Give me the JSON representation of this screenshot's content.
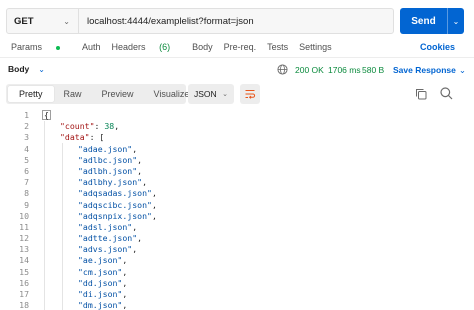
{
  "request": {
    "method": "GET",
    "url": "localhost:4444/examplelist?format=json",
    "send_label": "Send"
  },
  "request_tabs": [
    {
      "label": "Params",
      "has_dot": true
    },
    {
      "label": "Auth"
    },
    {
      "label": "Headers",
      "count": "(6)"
    },
    {
      "label": "Body"
    },
    {
      "label": "Pre-req."
    },
    {
      "label": "Tests"
    },
    {
      "label": "Settings"
    }
  ],
  "cookies_label": "Cookies",
  "response": {
    "body_label": "Body",
    "status": "200 OK",
    "time": "1706 ms",
    "size": "580 B",
    "save_label": "Save Response"
  },
  "format_tabs": [
    "Pretty",
    "Raw",
    "Preview",
    "Visualize"
  ],
  "active_format": "Pretty",
  "language": "JSON",
  "code_lines": [
    {
      "n": "1",
      "parts": [
        [
          "brace",
          "{"
        ]
      ]
    },
    {
      "n": "2",
      "parts": [
        [
          "key",
          "\"count\""
        ],
        [
          "pun",
          ": "
        ],
        [
          "num",
          "38"
        ],
        [
          "pun",
          ","
        ]
      ]
    },
    {
      "n": "3",
      "parts": [
        [
          "key",
          "\"data\""
        ],
        [
          "pun",
          ": ["
        ]
      ]
    },
    {
      "n": "4",
      "parts": [
        [
          "str",
          "\"adae.json\""
        ],
        [
          "pun",
          ","
        ]
      ]
    },
    {
      "n": "5",
      "parts": [
        [
          "str",
          "\"adlbc.json\""
        ],
        [
          "pun",
          ","
        ]
      ]
    },
    {
      "n": "6",
      "parts": [
        [
          "str",
          "\"adlbh.json\""
        ],
        [
          "pun",
          ","
        ]
      ]
    },
    {
      "n": "7",
      "parts": [
        [
          "str",
          "\"adlbhy.json\""
        ],
        [
          "pun",
          ","
        ]
      ]
    },
    {
      "n": "8",
      "parts": [
        [
          "str",
          "\"adqsadas.json\""
        ],
        [
          "pun",
          ","
        ]
      ]
    },
    {
      "n": "9",
      "parts": [
        [
          "str",
          "\"adqscibc.json\""
        ],
        [
          "pun",
          ","
        ]
      ]
    },
    {
      "n": "10",
      "parts": [
        [
          "str",
          "\"adqsnpix.json\""
        ],
        [
          "pun",
          ","
        ]
      ]
    },
    {
      "n": "11",
      "parts": [
        [
          "str",
          "\"adsl.json\""
        ],
        [
          "pun",
          ","
        ]
      ]
    },
    {
      "n": "12",
      "parts": [
        [
          "str",
          "\"adtte.json\""
        ],
        [
          "pun",
          ","
        ]
      ]
    },
    {
      "n": "13",
      "parts": [
        [
          "str",
          "\"advs.json\""
        ],
        [
          "pun",
          ","
        ]
      ]
    },
    {
      "n": "14",
      "parts": [
        [
          "str",
          "\"ae.json\""
        ],
        [
          "pun",
          ","
        ]
      ]
    },
    {
      "n": "15",
      "parts": [
        [
          "str",
          "\"cm.json\""
        ],
        [
          "pun",
          ","
        ]
      ]
    },
    {
      "n": "16",
      "parts": [
        [
          "str",
          "\"dd.json\""
        ],
        [
          "pun",
          ","
        ]
      ]
    },
    {
      "n": "17",
      "parts": [
        [
          "str",
          "\"di.json\""
        ],
        [
          "pun",
          ","
        ]
      ]
    },
    {
      "n": "18",
      "parts": [
        [
          "str",
          "\"dm.json\""
        ],
        [
          "pun",
          ","
        ]
      ]
    }
  ],
  "colors": {
    "accent": "#0265d2",
    "success": "#0a8a3c",
    "json_key": "#a31515",
    "json_string": "#0451a5",
    "json_number": "#098658"
  },
  "icons": [
    "chevron-down-icon",
    "globe-icon",
    "wrap-lines-icon",
    "copy-icon",
    "search-icon"
  ]
}
